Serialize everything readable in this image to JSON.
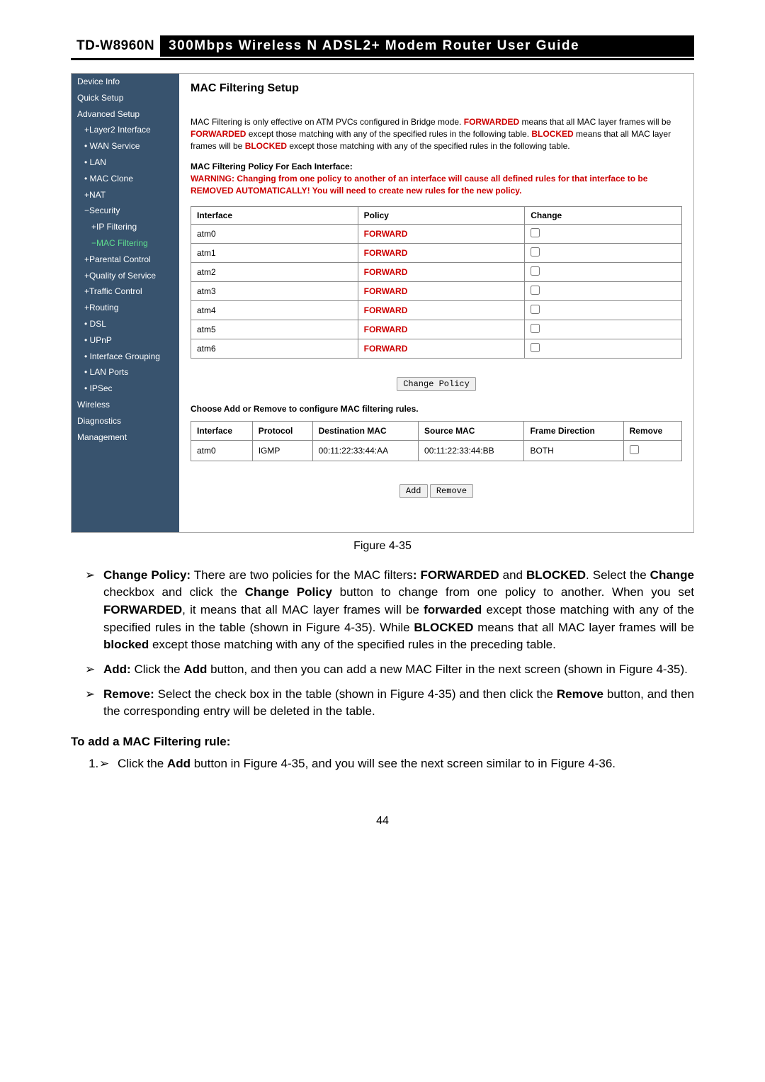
{
  "header": {
    "model": "TD-W8960N",
    "title": "300Mbps Wireless N ADSL2+ Modem Router User Guide"
  },
  "sidebar": {
    "items": [
      {
        "label": "Device Info",
        "lvl": 0
      },
      {
        "label": "Quick Setup",
        "lvl": 0
      },
      {
        "label": "Advanced Setup",
        "lvl": 0
      },
      {
        "label": "+Layer2 Interface",
        "lvl": 1
      },
      {
        "label": "• WAN Service",
        "lvl": 1
      },
      {
        "label": "• LAN",
        "lvl": 1
      },
      {
        "label": "• MAC Clone",
        "lvl": 1
      },
      {
        "label": "+NAT",
        "lvl": 1
      },
      {
        "label": "−Security",
        "lvl": 1
      },
      {
        "label": "+IP Filtering",
        "lvl": 2
      },
      {
        "label": "−MAC Filtering",
        "lvl": 2,
        "active": true
      },
      {
        "label": "+Parental Control",
        "lvl": 1
      },
      {
        "label": "+Quality of Service",
        "lvl": 1
      },
      {
        "label": "+Traffic Control",
        "lvl": 1
      },
      {
        "label": "+Routing",
        "lvl": 1
      },
      {
        "label": "• DSL",
        "lvl": 1
      },
      {
        "label": "• UPnP",
        "lvl": 1
      },
      {
        "label": "• Interface Grouping",
        "lvl": 1
      },
      {
        "label": "• LAN Ports",
        "lvl": 1
      },
      {
        "label": "• IPSec",
        "lvl": 1
      },
      {
        "label": "Wireless",
        "lvl": 0
      },
      {
        "label": "Diagnostics",
        "lvl": 0
      },
      {
        "label": "Management",
        "lvl": 0
      }
    ]
  },
  "content": {
    "title": "MAC Filtering Setup",
    "desc_pre": "MAC Filtering is only effective on ATM PVCs configured in Bridge mode. ",
    "desc_fwd": "FORWARDED",
    "desc_mid1": " means that all MAC layer frames will be ",
    "desc_fwd2": "FORWARDED",
    "desc_mid2": " except those matching with any of the specified rules in the following table. ",
    "desc_blk": "BLOCKED",
    "desc_mid3": " means that all MAC layer frames will be ",
    "desc_blk2": "BLOCKED",
    "desc_end": " except those matching with any of the specified rules in the following table.",
    "policy_hdr": "MAC Filtering Policy For Each Interface:",
    "warning": "WARNING: Changing from one policy to another of an interface will cause all defined rules for that interface to be REMOVED AUTOMATICALLY! You will need to create new rules for the new policy.",
    "table1_headers": {
      "c1": "Interface",
      "c2": "Policy",
      "c3": "Change"
    },
    "table1_rows": [
      {
        "iface": "atm0",
        "policy": "FORWARD"
      },
      {
        "iface": "atm1",
        "policy": "FORWARD"
      },
      {
        "iface": "atm2",
        "policy": "FORWARD"
      },
      {
        "iface": "atm3",
        "policy": "FORWARD"
      },
      {
        "iface": "atm4",
        "policy": "FORWARD"
      },
      {
        "iface": "atm5",
        "policy": "FORWARD"
      },
      {
        "iface": "atm6",
        "policy": "FORWARD"
      }
    ],
    "change_policy_btn": "Change Policy",
    "choose_text": "Choose Add or Remove to configure MAC filtering rules.",
    "table2_headers": {
      "c1": "Interface",
      "c2": "Protocol",
      "c3": "Destination MAC",
      "c4": "Source MAC",
      "c5": "Frame Direction",
      "c6": "Remove"
    },
    "table2_row": {
      "iface": "atm0",
      "proto": "IGMP",
      "dst": "00:11:22:33:44:AA",
      "src": "00:11:22:33:44:BB",
      "dir": "BOTH"
    },
    "add_btn": "Add",
    "remove_btn": "Remove"
  },
  "figcaption": "Figure 4-35",
  "doc": {
    "b1_label": "Change Policy:",
    "b1_text": " There are two policies for the MAC filters",
    "b1_bold1": ": FORWARDED",
    "b1_and": " and ",
    "b1_bold2": "BLOCKED",
    "b1_text2": ". Select the ",
    "b1_bold3": "Change",
    "b1_text3": " checkbox and click the ",
    "b1_bold4": "Change Policy",
    "b1_text4": " button to change from one policy to another. When you set ",
    "b1_bold5": "FORWARDED",
    "b1_text5": ", it means that all MAC layer frames will be ",
    "b1_bold6": "forwarded",
    "b1_text6": " except those matching with any of the specified rules in the table (shown in Figure 4-35). While ",
    "b1_bold7": "BLOCKED",
    "b1_text7": " means that all MAC layer frames will be ",
    "b1_bold8": "blocked",
    "b1_text8": " except those matching with any of the specified rules in the preceding table.",
    "b2_label": "Add:",
    "b2_text1": " Click the ",
    "b2_bold1": "Add",
    "b2_text2": " button, and then you can add a new MAC Filter in the next screen (shown in Figure 4-35).",
    "b3_label": "Remove:",
    "b3_text1": " Select the check box in the table (shown in Figure 4-35) and then click the ",
    "b3_bold1": "Remove",
    "b3_text2": " button, and then the corresponding entry will be deleted in the table.",
    "subhead": "To add a MAC Filtering rule:",
    "step1_a": "Click the ",
    "step1_b": "Add",
    "step1_c": " button in Figure 4-35, and you will see the next screen similar to in Figure 4-36."
  },
  "pagenum": "44"
}
